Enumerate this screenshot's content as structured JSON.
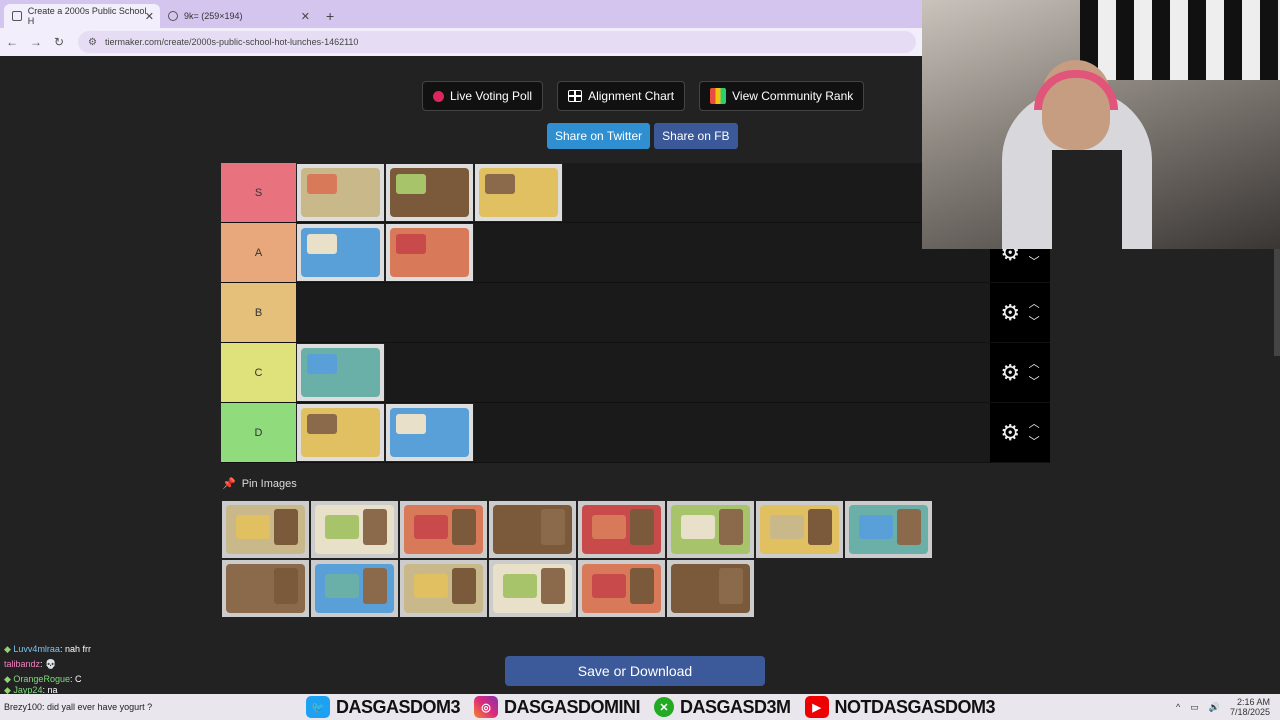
{
  "browser": {
    "tabs": [
      {
        "label": "Create a 2000s Public School H",
        "active": true
      },
      {
        "label": "9k= (259×194)",
        "active": false
      }
    ],
    "new_tab": "+",
    "url": "tiermaker.com/create/2000s-public-school-hot-lunches-1462110"
  },
  "top_buttons": {
    "live_voting": "Live Voting Poll",
    "alignment": "Alignment Chart",
    "community": "View Community Rank"
  },
  "share": {
    "twitter": "Share on Twitter",
    "fb": "Share on FB"
  },
  "tiers": [
    {
      "label": "S",
      "color": "#e8737f",
      "items": 3
    },
    {
      "label": "A",
      "color": "#e8a87c",
      "items": 2
    },
    {
      "label": "B",
      "color": "#e4c07a",
      "items": 0
    },
    {
      "label": "C",
      "color": "#dfe27a",
      "items": 1
    },
    {
      "label": "D",
      "color": "#90db7c",
      "items": 2
    }
  ],
  "pin_label": "Pin Images",
  "pool_count": 14,
  "save_button": "Save or Download",
  "chat": [
    {
      "user": "Luvv4mlraa",
      "msg": ": nah frr"
    },
    {
      "user": "talibandz",
      "msg": ": 💀"
    },
    {
      "user": "OrangeRogue",
      "msg": ": C"
    },
    {
      "user": "Jayp24",
      "msg": ": na"
    },
    {
      "user": "Brezy100",
      "msg": ": did yall ever have yogurt ?"
    }
  ],
  "socials": [
    "DASGASDOM3",
    "DASGASDOMINI",
    "DASGASD3M",
    "NOTDASGASDOM3"
  ],
  "clock": {
    "time": "2:16 AM",
    "date": "7/18/2025"
  }
}
